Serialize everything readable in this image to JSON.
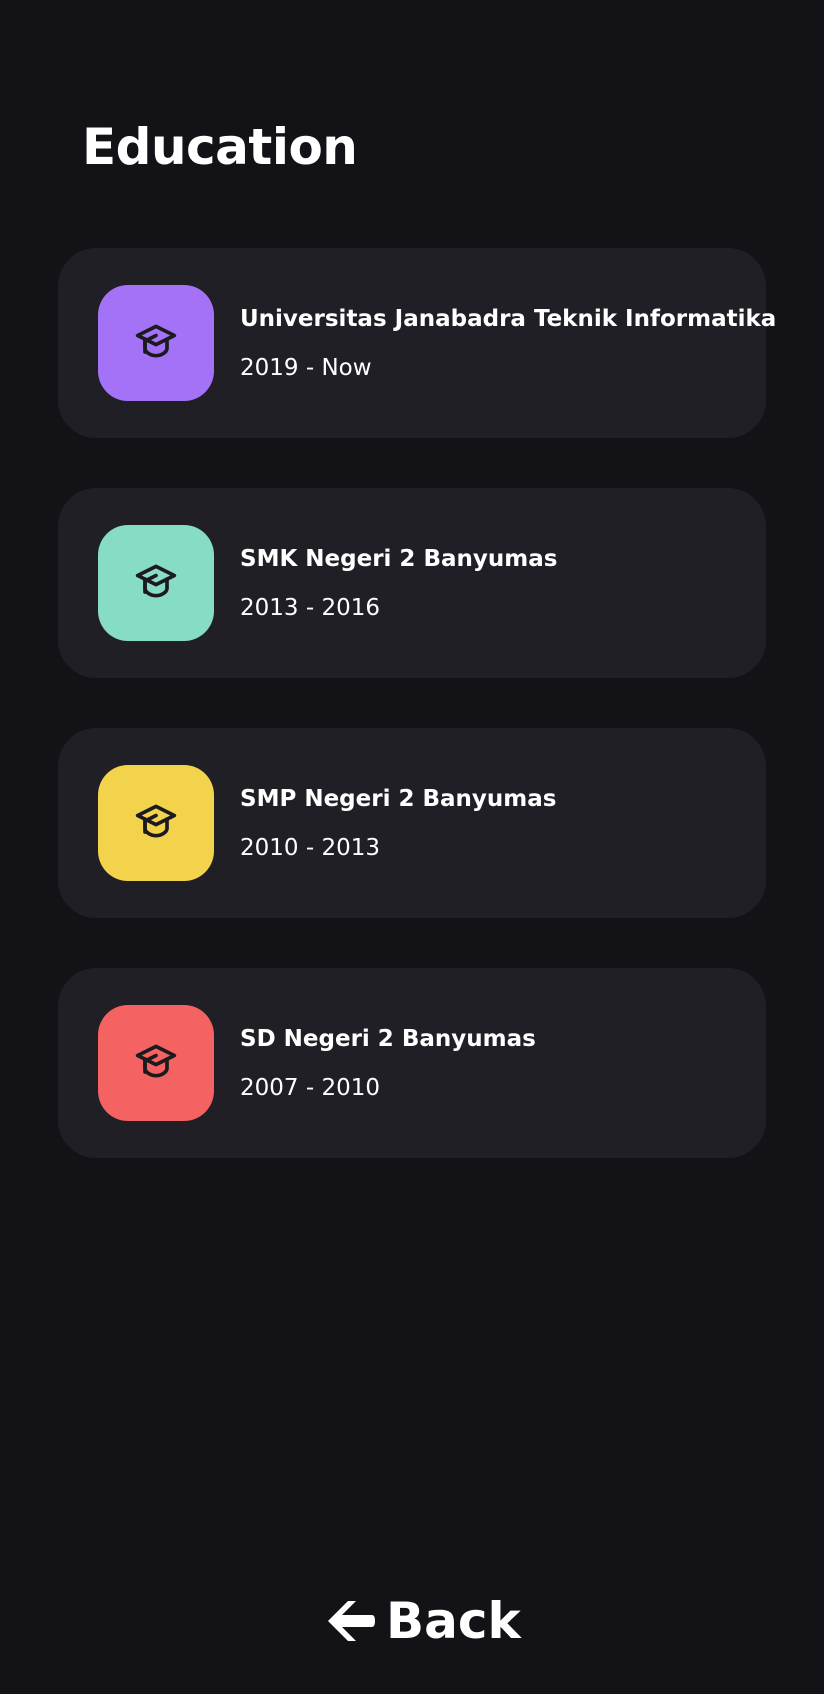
{
  "header": {
    "title": "Education"
  },
  "education": [
    {
      "name": "Universitas Janabadra Teknik Informatika",
      "period": "2019 - Now",
      "color": "#a472f6",
      "icon": "graduation-cap-icon"
    },
    {
      "name": "SMK Negeri 2 Banyumas",
      "period": "2013 - 2016",
      "color": "#86dcc4",
      "icon": "graduation-cap-icon"
    },
    {
      "name": "SMP Negeri 2 Banyumas",
      "period": "2010 - 2013",
      "color": "#f3d34b",
      "icon": "graduation-cap-icon"
    },
    {
      "name": "SD Negeri 2 Banyumas",
      "period": "2007 - 2010",
      "color": "#f46262",
      "icon": "graduation-cap-icon"
    }
  ],
  "footer": {
    "back_label": "Back",
    "back_icon": "arrow-left-icon"
  },
  "colors": {
    "background": "#131217",
    "card": "#201f25",
    "text": "#ffffff",
    "icon_stroke": "#1b1a1f"
  }
}
